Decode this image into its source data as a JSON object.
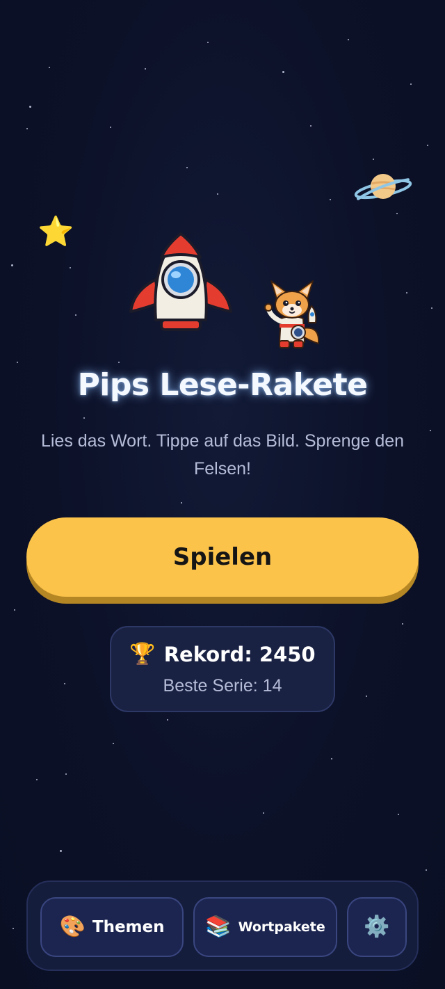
{
  "app": {
    "title": "Pips Lese-Rakete",
    "subtitle": "Lies das Wort. Tippe auf das Bild. Sprenge den Felsen!"
  },
  "actions": {
    "play_label": "Spielen"
  },
  "stats": {
    "record_label": "Rekord: 2450",
    "streak_label": "Beste Serie: 14"
  },
  "nav": {
    "items": [
      {
        "label": "Themen",
        "icon": "palette-icon"
      },
      {
        "label": "Wortpakete",
        "icon": "books-icon"
      },
      {
        "label": "",
        "icon": "gear-icon"
      }
    ]
  },
  "decor": {
    "icons": [
      "star-icon",
      "saturn-icon",
      "rocket-icon",
      "fox-astronaut-icon",
      "trophy-icon"
    ]
  },
  "colors": {
    "background": "#0d1229",
    "primary_button": "#fcc34b",
    "card": "#1a2244",
    "title_glow": "#8cbeff"
  }
}
